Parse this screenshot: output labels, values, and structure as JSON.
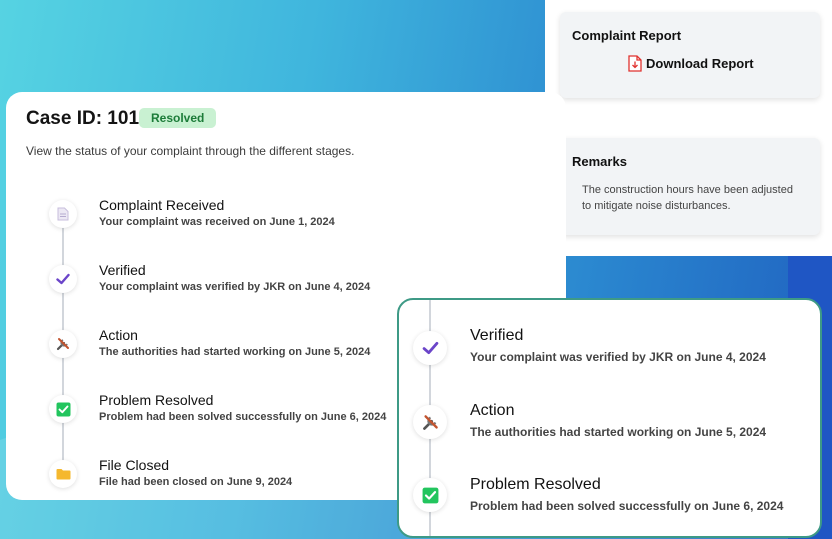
{
  "case": {
    "title": "Case ID: 101",
    "status": "Resolved",
    "intro": "View the status of your complaint through the different stages."
  },
  "steps": [
    {
      "title": "Complaint Received",
      "desc": "Your complaint was received on June 1, 2024",
      "icon": "document-icon"
    },
    {
      "title": "Verified",
      "desc": "Your complaint was verified by JKR on June 4, 2024",
      "icon": "checkmark-icon"
    },
    {
      "title": "Action",
      "desc": "The authorities had started working on June 5, 2024",
      "icon": "tools-icon"
    },
    {
      "title": "Problem Resolved",
      "desc": "Problem had been solved successfully on June 6, 2024",
      "icon": "check-box-icon"
    },
    {
      "title": "File Closed",
      "desc": "File had been closed on June 9, 2024",
      "icon": "folder-icon"
    }
  ],
  "report": {
    "title": "Complaint Report",
    "download_label": "Download Report"
  },
  "remarks": {
    "title": "Remarks",
    "text": "The construction hours have been adjusted to mitigate noise disturbances."
  },
  "colors": {
    "badge_bg": "#c9f1d2",
    "badge_text": "#1c7c39",
    "verified": "#6b45c9",
    "resolved": "#22c55e",
    "folder": "#f5b82e",
    "pdf": "#e0322f",
    "zoom_border": "#3e9a86"
  }
}
